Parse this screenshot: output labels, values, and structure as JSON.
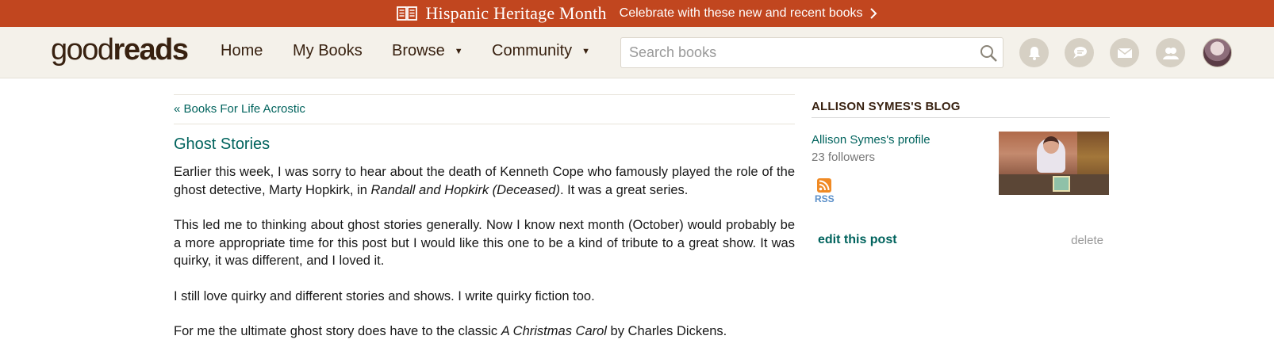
{
  "banner": {
    "title": "Hispanic Heritage Month",
    "cta": "Celebrate with these new and recent books",
    "icons": {
      "book": "open-book-icon",
      "arrow": "chevron-right-icon"
    }
  },
  "header": {
    "logo_good": "good",
    "logo_reads": "reads",
    "nav": [
      {
        "label": "Home"
      },
      {
        "label": "My Books"
      },
      {
        "label": "Browse",
        "caret": "▼"
      },
      {
        "label": "Community",
        "caret": "▼"
      }
    ],
    "search": {
      "placeholder": "Search books",
      "value": ""
    },
    "icon_buttons": [
      "bell-icon",
      "chat-icon",
      "mail-icon",
      "friends-icon"
    ],
    "colors": {
      "banner": "#c1461f",
      "header_bg": "#f4f1ea",
      "brand_text": "#382110",
      "link": "#00635d"
    }
  },
  "main": {
    "back_link": "« Books For Life Acrostic",
    "title": "Ghost Stories",
    "paragraphs": [
      {
        "before": "Earlier this week, I was sorry to hear about the death of Kenneth Cope who famously played the role of the ghost detective, Marty Hopkirk, in ",
        "em": "Randall and Hopkirk (Deceased)",
        "after": ". It was a great series."
      },
      {
        "text": "This led me to thinking about ghost stories generally. Now I know next month (October) would probably be a more appropriate time for this post but I would like this one to be a kind of tribute to a great show. It was quirky, it was different, and I loved it."
      },
      {
        "text": "I still love quirky and different stories and shows. I write quirky fiction too."
      },
      {
        "before": "For me the ultimate ghost story does have to the classic ",
        "em": "A Christmas Carol",
        "after": " by Charles Dickens."
      }
    ]
  },
  "sidebar": {
    "blog_title": "ALLISON SYMES'S BLOG",
    "profile_link": "Allison Symes's profile",
    "followers": "23 followers",
    "rss_label": "RSS",
    "edit_link": "edit this post",
    "delete_link": "delete"
  }
}
